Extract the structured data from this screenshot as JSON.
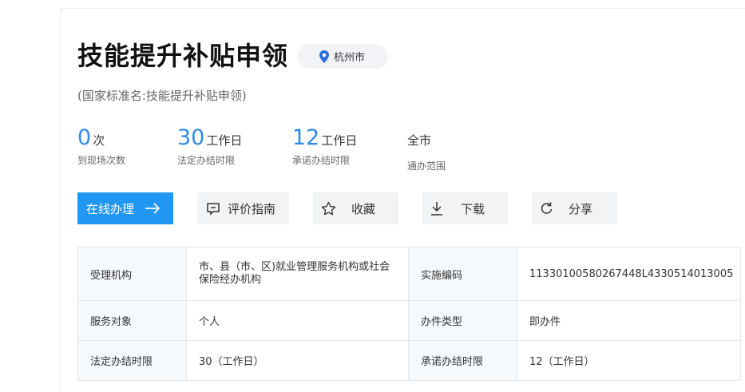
{
  "header": {
    "title": "技能提升补贴申领",
    "location": "杭州市",
    "subtitle": "(国家标准名:技能提升补贴申领)"
  },
  "stats": [
    {
      "value": "0",
      "unit": "次",
      "label": "到现场次数"
    },
    {
      "value": "30",
      "unit": "工作日",
      "label": "法定办结时限"
    },
    {
      "value": "12",
      "unit": "工作日",
      "label": "承诺办结时限"
    },
    {
      "value": "全市",
      "unit": "",
      "label": "通办范围"
    }
  ],
  "actions": {
    "online": "在线办理",
    "evaluate": "评价指南",
    "favorite": "收藏",
    "download": "下载",
    "share": "分享"
  },
  "info": {
    "rows": [
      {
        "k1": "受理机构",
        "v1": "市、县（市、区)就业管理服务机构或社会保险经办机构",
        "k2": "实施编码",
        "v2": "11330100580267448L4330514013005"
      },
      {
        "k1": "服务对象",
        "v1": "个人",
        "k2": "办件类型",
        "v2": "即办件"
      },
      {
        "k1": "法定办结时限",
        "v1": "30（工作日）",
        "k2": "承诺办结时限",
        "v2": "12（工作日）"
      }
    ]
  },
  "colors": {
    "accent": "#2196f3",
    "stat_number": "#2e8ae6",
    "location_pin": "#2e6fe0"
  }
}
